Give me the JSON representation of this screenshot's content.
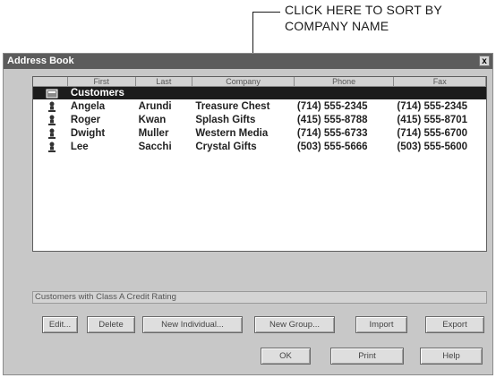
{
  "callout": {
    "line1": "CLICK HERE TO SORT BY",
    "line2": "COMPANY NAME"
  },
  "window": {
    "title": "Address Book",
    "close_glyph": "x"
  },
  "list": {
    "columns": [
      "First",
      "Last",
      "Company",
      "Phone",
      "Fax"
    ],
    "group_row": {
      "name": "Customers"
    },
    "rows": [
      {
        "first": "Angela",
        "last": "Arundi",
        "company": "Treasure Chest",
        "phone": "(714) 555-2345",
        "fax": "(714) 555-2345"
      },
      {
        "first": "Roger",
        "last": "Kwan",
        "company": "Splash Gifts",
        "phone": "(415) 555-8788",
        "fax": "(415) 555-8701"
      },
      {
        "first": "Dwight",
        "last": "Muller",
        "company": "Western Media",
        "phone": "(714) 555-6733",
        "fax": "(714) 555-6700"
      },
      {
        "first": "Lee",
        "last": "Sacchi",
        "company": "Crystal Gifts",
        "phone": "(503) 555-5666",
        "fax": "(503) 555-5600"
      }
    ]
  },
  "status_text": "Customers with Class A Credit Rating",
  "buttons": {
    "edit": "Edit...",
    "delete": "Delete",
    "new_individual": "New Individual...",
    "new_group": "New Group...",
    "import": "Import",
    "export": "Export",
    "ok": "OK",
    "print": "Print",
    "help": "Help"
  },
  "icons": {
    "group": "group-book-icon",
    "person": "person-icon"
  },
  "colors": {
    "title_bar": "#5c5c5c",
    "selection": "#1c1c1c",
    "window_bg": "#c8c8c8"
  }
}
